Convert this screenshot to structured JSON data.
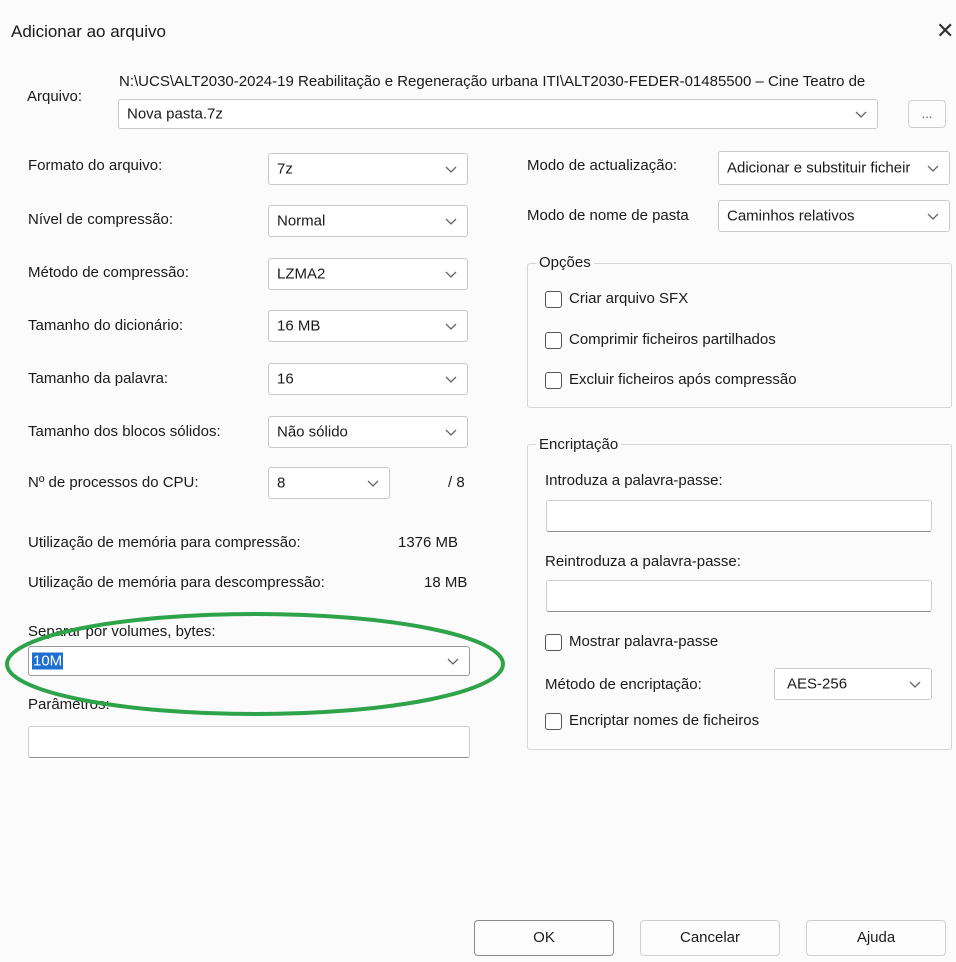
{
  "window": {
    "title": "Adicionar ao arquivo",
    "close_glyph": "✕"
  },
  "archive": {
    "label": "Arquivo:",
    "path": "N:\\UCS\\ALT2030-2024-19 Reabilitação e Regeneração urbana ITI\\ALT2030-FEDER-01485500 – Cine Teatro de",
    "filename": "Nova pasta.7z",
    "browse_label": "..."
  },
  "left": {
    "format": {
      "label": "Formato do arquivo:",
      "value": "7z"
    },
    "compression_level": {
      "label": "Nível de compressão:",
      "value": "Normal"
    },
    "compression_method": {
      "label": "Método de compressão:",
      "value": "LZMA2"
    },
    "dictionary_size": {
      "label": "Tamanho do dicionário:",
      "value": "16 MB"
    },
    "word_size": {
      "label": "Tamanho da palavra:",
      "value": "16"
    },
    "solid_block": {
      "label": "Tamanho dos blocos sólidos:",
      "value": "Não sólido"
    },
    "cpu_threads": {
      "label": "Nº de processos do CPU:",
      "value": "8",
      "max": "/ 8"
    },
    "mem_compress": {
      "label": "Utilização de memória para compressão:",
      "value": "1376 MB"
    },
    "mem_decompress": {
      "label": "Utilização de memória para descompressão:",
      "value": "18 MB"
    },
    "split_volumes": {
      "label": "Separar por volumes, bytes:",
      "value": "10M"
    },
    "parameters": {
      "label": "Parâmetros:",
      "value": ""
    }
  },
  "right": {
    "update_mode": {
      "label": "Modo de actualização:",
      "value": "Adicionar e substituir ficheir"
    },
    "path_mode": {
      "label": "Modo de nome de pasta",
      "value": "Caminhos relativos"
    },
    "options": {
      "title": "Opções",
      "sfx": "Criar arquivo SFX",
      "shared": "Comprimir ficheiros partilhados",
      "delete_after": "Excluir ficheiros após compressão"
    },
    "encryption": {
      "title": "Encriptação",
      "password_label": "Introduza a palavra-passe:",
      "reenter_label": "Reintroduza a palavra-passe:",
      "show_password": "Mostrar palavra-passe",
      "method_label": "Método de encriptação:",
      "method_value": "AES-256",
      "encrypt_names": "Encriptar nomes de ficheiros"
    }
  },
  "buttons": {
    "ok": "OK",
    "cancel": "Cancelar",
    "help": "Ajuda"
  },
  "colors": {
    "annotation": "#2fa34a",
    "selection": "#1f6fd1"
  }
}
